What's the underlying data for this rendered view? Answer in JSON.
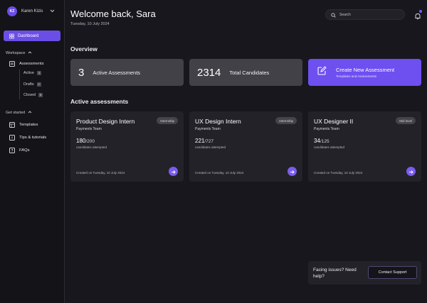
{
  "user": {
    "initials": "KZ",
    "name": "Karen Kizis"
  },
  "sidebar": {
    "dashboard_label": "Dashboard",
    "workspace_label": "Workspace",
    "assessments_label": "Assessments",
    "subitems": [
      {
        "label": "Active",
        "count": "3"
      },
      {
        "label": "Drafts",
        "count": "2"
      },
      {
        "label": "Closed",
        "count": "6"
      }
    ],
    "get_started_label": "Get started",
    "get_started_items": [
      {
        "label": "Templates",
        "icon": "templates-icon"
      },
      {
        "label": "Tips & tutorials",
        "icon": "tips-icon"
      },
      {
        "label": "FAQs",
        "icon": "faqs-icon"
      }
    ]
  },
  "header": {
    "title": "Welcome back, Sara",
    "date": "Tuesday, 10 July 2024",
    "search_placeholder": "Search"
  },
  "overview": {
    "heading": "Overview",
    "stats": [
      {
        "value": "3",
        "label": "Active Assessments"
      },
      {
        "value": "2314",
        "label": "Total Candidates"
      }
    ],
    "create": {
      "title": "Create New Assessment",
      "subtitle": "Templates and Assessments"
    }
  },
  "active": {
    "heading": "Active assessments",
    "cards": [
      {
        "title": "Product Design Intern",
        "team": "Payments Team",
        "tag": "Internship",
        "attempted": "180",
        "total": "/200",
        "caption": "candidates attempted",
        "created": "Created on Tuesday, 10 July 2024"
      },
      {
        "title": "UX Design Intern",
        "team": "Payments Team",
        "tag": "Internship",
        "attempted": "221",
        "total": "/727",
        "caption": "candidates attempted",
        "created": "Created on Tuesday, 10 July 2024"
      },
      {
        "title": "UX Designer II",
        "team": "Payments Team",
        "tag": "Mid level",
        "attempted": "34",
        "total": "/125",
        "caption": "candidates attempted",
        "created": "Created on Tuesday, 10 July 2024"
      }
    ]
  },
  "help": {
    "question": "Facing issues? Need help?",
    "button": "Contact Support"
  },
  "colors": {
    "accent": "#6e4ff0",
    "background": "#18171d",
    "sidebar": "#141318",
    "card": "#232228"
  }
}
